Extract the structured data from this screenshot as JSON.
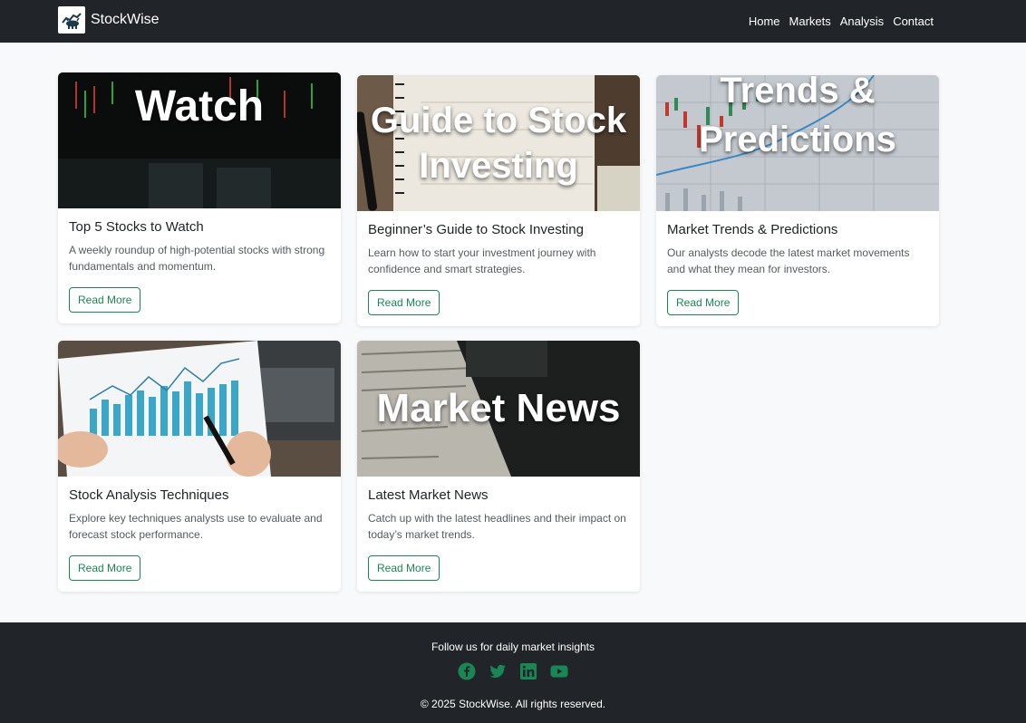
{
  "brand": {
    "name": "StockWise",
    "logo_icon": "bull-chart-icon"
  },
  "nav": {
    "items": [
      "Home",
      "Markets",
      "Analysis",
      "Contact"
    ]
  },
  "cards": [
    {
      "image_text": "Stocks to Watch",
      "title": "Top 5 Stocks to Watch",
      "text": "A weekly roundup of high-potential stocks with strong fundamentals and momentum.",
      "button": "Read More"
    },
    {
      "image_text": "Guide to Stock Investing",
      "title": "Beginner’s Guide to Stock Investing",
      "text": "Learn how to start your investment journey with confidence and smart strategies.",
      "button": "Read More"
    },
    {
      "image_text": "Trends & Predictions",
      "title": "Market Trends & Predictions",
      "text": "Our analysts decode the latest market movements and what they mean for investors.",
      "button": "Read More"
    },
    {
      "image_text": "",
      "title": "Stock Analysis Techniques",
      "text": "Explore key techniques analysts use to evaluate and forecast stock performance.",
      "button": "Read More"
    },
    {
      "image_text": "Market News",
      "title": "Latest Market News",
      "text": "Catch up with the latest headlines and their impact on today’s market trends.",
      "button": "Read More"
    }
  ],
  "footer": {
    "tagline": "Follow us for daily market insights",
    "socials": [
      "facebook-icon",
      "twitter-icon",
      "linkedin-icon",
      "youtube-icon"
    ],
    "copyright": "© 2025 StockWise. All rights reserved."
  },
  "colors": {
    "navbar": "#212529",
    "accent": "#198754",
    "background": "#f8f9fa"
  }
}
